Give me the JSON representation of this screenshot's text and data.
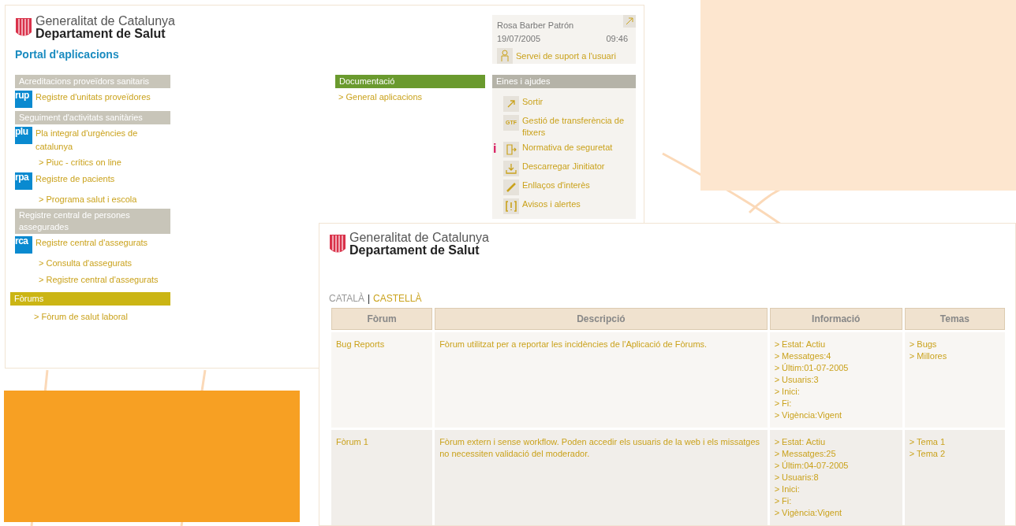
{
  "portal": {
    "logo": {
      "line1": "Generalitat de Catalunya",
      "line2": "Departament de Salut"
    },
    "title": "Portal d'aplicacions",
    "user": {
      "name": "Rosa Barber Patrón",
      "date": "19/07/2005",
      "time": "09:46",
      "support": "Servei de suport a l'usuari"
    },
    "sections": [
      {
        "heading": "Acreditacions proveïdors sanitaris",
        "kind": "gray",
        "apps": [
          {
            "badge": "rup",
            "label": "Registre d'unitats proveïdores"
          }
        ]
      },
      {
        "heading": "Seguiment d'activitats sanitàries",
        "kind": "gray",
        "apps": [
          {
            "badge": "plu",
            "label": "Pla integral d'urgències de catalunya",
            "links": [
              "> Piuc - crítics on line"
            ]
          },
          {
            "badge": "rpa",
            "label": "Registre de pacients",
            "links": [
              "> Programa salut i escola"
            ]
          }
        ]
      },
      {
        "heading": "Registre central de persones assegurades",
        "kind": "gray",
        "apps": [
          {
            "badge": "rca",
            "label": "Registre central d'assegurats",
            "links": [
              "> Consulta d'assegurats",
              "> Registre central d'assegurats"
            ]
          }
        ]
      },
      {
        "heading": "Fòrums",
        "kind": "yellow",
        "links": [
          "> Fòrum de salut laboral"
        ]
      }
    ],
    "documentation": {
      "heading": "Documentació",
      "links": [
        "> General aplicacions"
      ]
    },
    "tools": {
      "heading": "Eines i ajudes",
      "items": [
        {
          "label": "Sortir"
        },
        {
          "label": "Gestió de transferència de fitxers",
          "badge": "GTF"
        },
        {
          "label": "Normativa de seguretat",
          "marker": "i"
        },
        {
          "label": "Descarregar Jinitiator"
        },
        {
          "label": "Enllaços d'interès"
        },
        {
          "label": "Avisos i alertes"
        }
      ]
    }
  },
  "forums": {
    "logo": {
      "line1": "Generalitat de Catalunya",
      "line2": "Departament de Salut"
    },
    "languages": [
      {
        "label": "CATALÀ",
        "selected": true
      },
      {
        "label": "CASTELLÀ",
        "selected": false
      }
    ],
    "language_separator": "|",
    "table": {
      "columns": [
        "Fòrum",
        "Descripció",
        "Informació",
        "Temas"
      ],
      "rows": [
        {
          "forum": "Bug Reports",
          "description": "Fòrum utilitzat per a reportar les incidències de l'Aplicació de Fòrums.",
          "info": [
            "> Estat: Actiu",
            "> Messatges:4",
            "> Últim:01-07-2005",
            "> Usuaris:3",
            "> Inici:",
            "> Fi:",
            "> Vigència:Vigent"
          ],
          "topics": [
            "> Bugs",
            "> Millores"
          ]
        },
        {
          "forum": "Fòrum 1",
          "description": "Fòrum extern i sense workflow. Poden accedir els usuaris de la web i els missatges no necessiten validació del moderador.",
          "info": [
            "> Estat: Actiu",
            "> Messatges:25",
            "> Últim:04-07-2005",
            "> Usuaris:8",
            "> Inici:",
            "> Fi:",
            "> Vigència:Vigent"
          ],
          "topics": [
            "> Tema 1",
            "> Tema 2"
          ]
        }
      ]
    }
  }
}
